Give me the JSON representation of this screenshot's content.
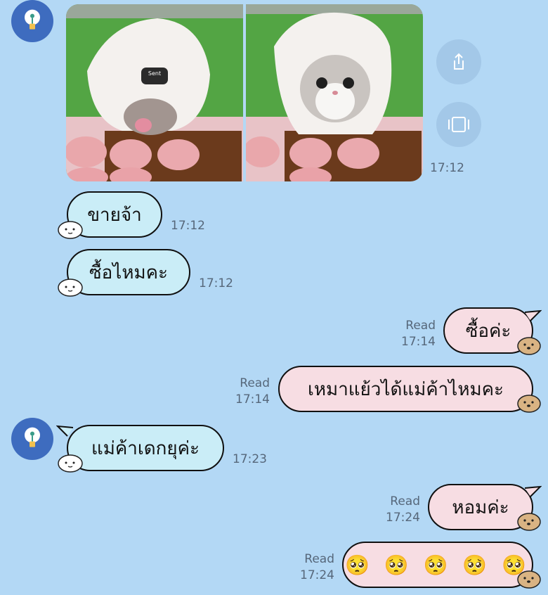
{
  "photos": {
    "left": {
      "overlay_label": "Sent"
    }
  },
  "actions": {
    "share_icon": "share-icon",
    "gallery_icon": "gallery-icon"
  },
  "messages": [
    {
      "type": "image",
      "side": "in",
      "time": "17:12"
    },
    {
      "side": "in",
      "text": "ขายจ้า",
      "time": "17:12"
    },
    {
      "side": "in",
      "text": "ซื้อไหมคะ",
      "time": "17:12"
    },
    {
      "side": "out",
      "text": "ซื้อค่ะ",
      "status": "Read",
      "time": "17:14"
    },
    {
      "side": "out",
      "text": "เหมาแย้วได้แม่ค้าไหมคะ",
      "status": "Read",
      "time": "17:14"
    },
    {
      "side": "in",
      "text": "แม่ค้าเดกยุค่ะ",
      "time": "17:23"
    },
    {
      "side": "out",
      "text": "หอมค่ะ",
      "status": "Read",
      "time": "17:24"
    },
    {
      "side": "out",
      "text": "🥺 🥺 🥺 🥺 🥺",
      "status": "Read",
      "time": "17:24"
    }
  ],
  "colors": {
    "background": "#b3d8f5",
    "incoming_bubble": "#caedf7",
    "outgoing_bubble": "#f7dde3",
    "avatar": "#3e6cbf"
  }
}
